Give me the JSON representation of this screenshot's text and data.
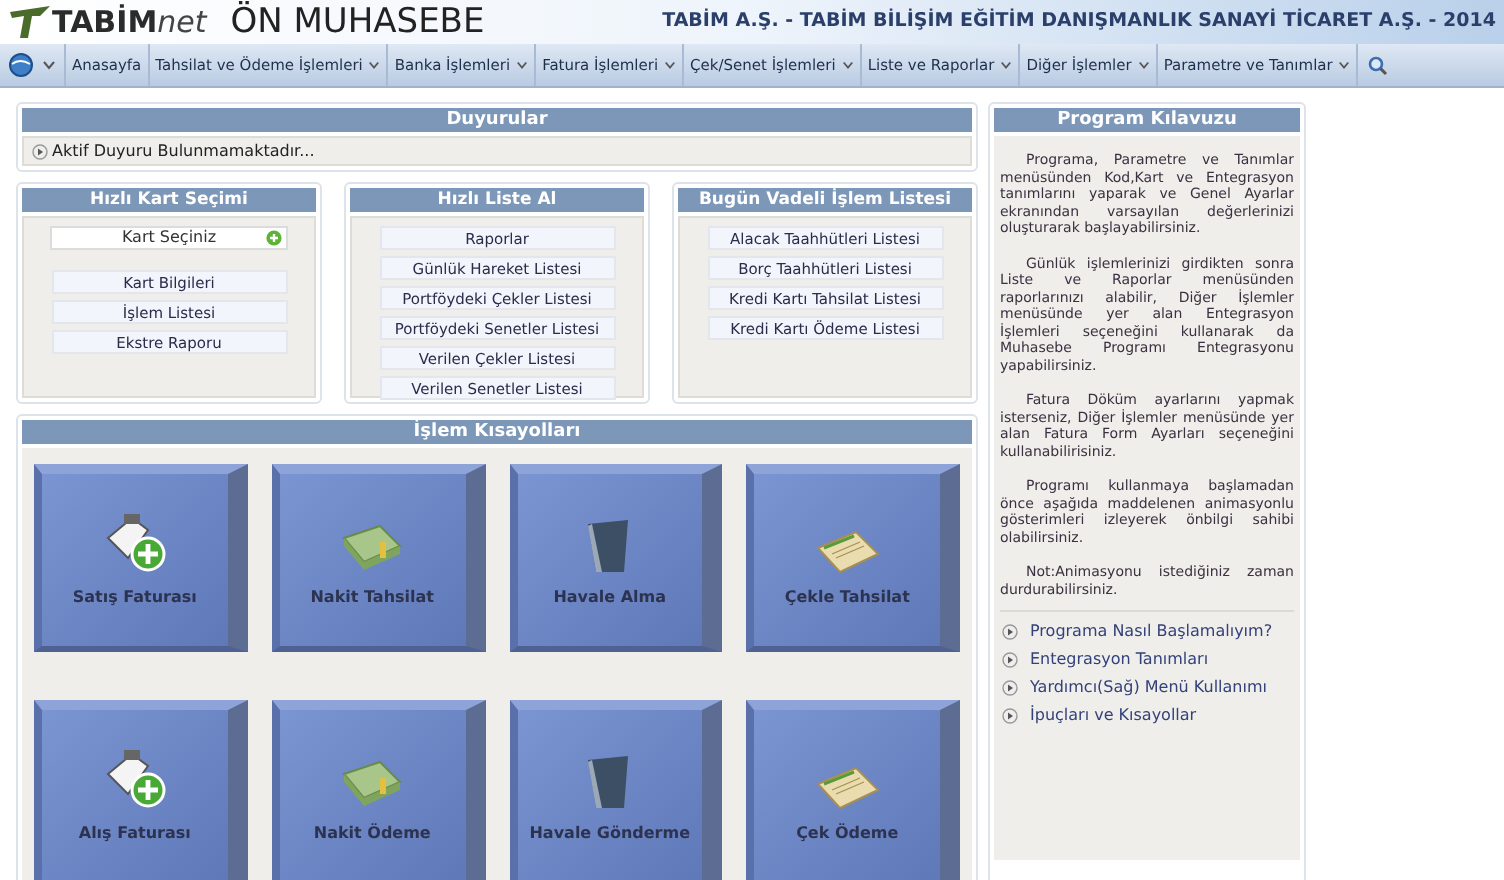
{
  "header": {
    "logo_bold": "TABİM",
    "logo_light": "net",
    "title": "ÖN MUHASEBE",
    "company": "TABİM A.Ş. - TABİM BİLİŞİM EĞİTİM DANIŞMANLIK SANAYİ TİCARET A.Ş. - 2014"
  },
  "menu": [
    {
      "label": "Anasayfa",
      "dropdown": false
    },
    {
      "label": "Tahsilat ve Ödeme İşlemleri",
      "dropdown": true
    },
    {
      "label": "Banka İşlemleri",
      "dropdown": true
    },
    {
      "label": "Fatura İşlemleri",
      "dropdown": true
    },
    {
      "label": "Çek/Senet İşlemleri",
      "dropdown": true
    },
    {
      "label": "Liste ve Raporlar",
      "dropdown": true
    },
    {
      "label": "Diğer İşlemler",
      "dropdown": true
    },
    {
      "label": "Parametre ve Tanımlar",
      "dropdown": true
    }
  ],
  "announcements": {
    "title": "Duyurular",
    "text": "Aktif Duyuru Bulunmamaktadır..."
  },
  "quick_card": {
    "title": "Hızlı Kart Seçimi",
    "placeholder": "Kart Seçiniz",
    "buttons": [
      "Kart Bilgileri",
      "İşlem Listesi",
      "Ekstre Raporu"
    ]
  },
  "quick_list": {
    "title": "Hızlı Liste Al",
    "buttons": [
      "Raporlar",
      "Günlük Hareket Listesi",
      "Portföydeki Çekler Listesi",
      "Portföydeki Senetler Listesi",
      "Verilen Çekler Listesi",
      "Verilen Senetler Listesi"
    ]
  },
  "due_today": {
    "title": "Bugün Vadeli İşlem Listesi",
    "buttons": [
      "Alacak Taahhütleri Listesi",
      "Borç Taahhütleri Listesi",
      "Kredi Kartı Tahsilat Listesi",
      "Kredi Kartı Ödeme Listesi"
    ]
  },
  "shortcuts": {
    "title": "İşlem Kısayolları",
    "tiles": [
      {
        "label": "Satış Faturası",
        "kind": "invoice"
      },
      {
        "label": "Nakit Tahsilat",
        "kind": "cash"
      },
      {
        "label": "Havale Alma",
        "kind": "folder"
      },
      {
        "label": "Çekle Tahsilat",
        "kind": "cheque"
      },
      {
        "label": "Alış Faturası",
        "kind": "invoice"
      },
      {
        "label": "Nakit Ödeme",
        "kind": "cash"
      },
      {
        "label": "Havale Gönderme",
        "kind": "folder"
      },
      {
        "label": "Çek Ödeme",
        "kind": "cheque"
      }
    ]
  },
  "guide": {
    "title": "Program Kılavuzu",
    "paragraphs": [
      "Programa, Parametre ve Tanımlar menüsünden Kod,Kart ve Entegrasyon tanımlarını yaparak ve Genel Ayarlar ekranından varsayılan değerlerinizi oluşturarak başlayabilirsiniz.",
      "Günlük işlemlerinizi girdikten sonra Liste ve Raporlar menüsünden raporlarınızı alabilir, Diğer İşlemler menüsünde yer alan Entegrasyon İşlemleri seçeneğini kullanarak da Muhasebe Programı Entegrasyonu yapabilirsiniz.",
      "Fatura Döküm ayarlarını yapmak isterseniz, Diğer İşlemler menüsünde yer alan Fatura Form Ayarları seçeneğini kullanabilirisiniz.",
      "Programı kullanmaya başlamadan önce aşağıda maddelenen animasyonlu gösterimleri izleyerek önbilgi sahibi olabilirsiniz.",
      "Not:Animasyonu istediğiniz zaman durdurabilirsiniz."
    ],
    "links": [
      "Programa Nasıl Başlamalıyım?",
      "Entegrasyon Tanımları",
      "Yardımcı(Sağ) Menü Kullanımı",
      "İpuçları ve Kısayollar"
    ]
  }
}
